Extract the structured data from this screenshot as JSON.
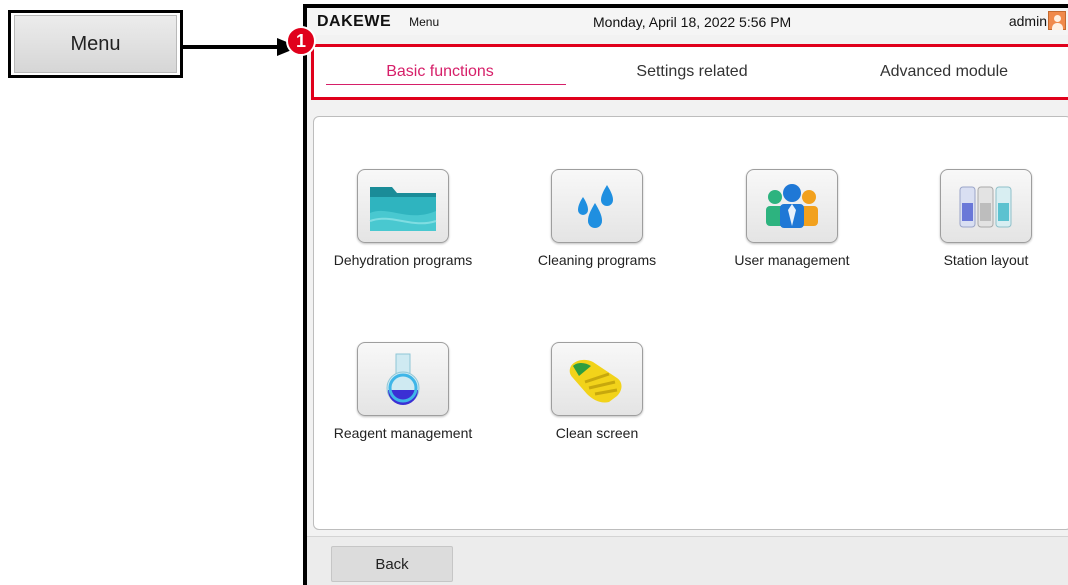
{
  "callout": {
    "menu_label": "Menu"
  },
  "badge": "1",
  "status": {
    "brand": "DAKEWE",
    "screen": "Menu",
    "datetime": "Monday, April 18, 2022  5:56 PM",
    "user": "admin"
  },
  "tabs": [
    {
      "label": "Basic functions",
      "active": true
    },
    {
      "label": "Settings related",
      "active": false
    },
    {
      "label": "Advanced module",
      "active": false
    }
  ],
  "tiles": [
    {
      "label": "Dehydration programs",
      "icon": "folder-icon"
    },
    {
      "label": "Cleaning programs",
      "icon": "water-drops-icon"
    },
    {
      "label": "User management",
      "icon": "users-icon"
    },
    {
      "label": "Station layout",
      "icon": "station-icon"
    },
    {
      "label": "Reagent management",
      "icon": "flask-icon"
    },
    {
      "label": "Clean screen",
      "icon": "glove-icon"
    }
  ],
  "footer": {
    "back_label": "Back"
  },
  "colors": {
    "active_tab": "#d61f69",
    "highlight": "#e0001b"
  }
}
